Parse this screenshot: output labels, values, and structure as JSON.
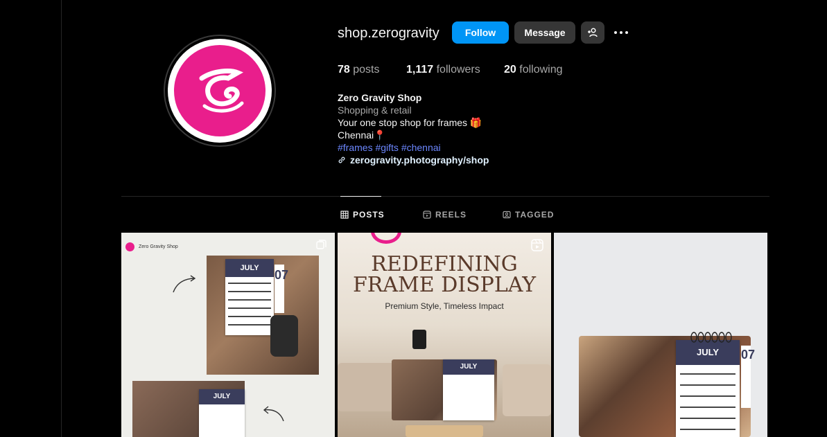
{
  "profile": {
    "username": "shop.zerogravity",
    "follow_label": "Follow",
    "message_label": "Message",
    "posts_count": "78",
    "posts_label": "posts",
    "followers_count": "1,117",
    "followers_label": "followers",
    "following_count": "20",
    "following_label": "following",
    "display_name": "Zero Gravity Shop",
    "category": "Shopping & retail",
    "bio_line1": "Your one stop shop for frames 🎁",
    "bio_line2": "Chennai📍",
    "hashtags": [
      "#frames",
      "#gifts",
      "#chennai"
    ],
    "link": "zerogravity.photography/shop"
  },
  "tabs": [
    {
      "label": "POSTS",
      "active": true
    },
    {
      "label": "REELS",
      "active": false
    },
    {
      "label": "TAGGED",
      "active": false
    }
  ],
  "posts": [
    {
      "brand": "Zero Gravity Shop",
      "month": "JULY",
      "month_b": "JULY",
      "day_digits": "07"
    },
    {
      "title1": "REDEFINING",
      "title2": "FRAME DISPLAY",
      "subtitle": "Premium Style, Timeless Impact",
      "month": "JULY"
    },
    {
      "month": "JULY",
      "day_digits": "07"
    }
  ],
  "colors": {
    "accent": "#0095f6",
    "brand": "#e91e8c",
    "hashtag": "#6c87ff"
  }
}
